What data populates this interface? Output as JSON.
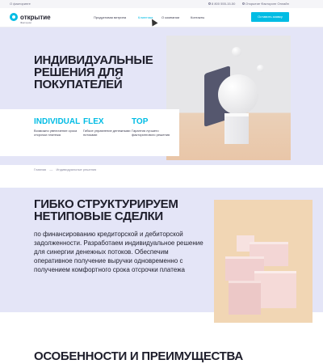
{
  "topbar": {
    "about": "О факторинге",
    "phone": "8 800 555-15-50",
    "online": "Открытие Факторинг Онлайн"
  },
  "header": {
    "logo_text": "открытие",
    "logo_sub": "Факторинг",
    "nav": [
      {
        "label": "Продуктовая витрина",
        "active": false
      },
      {
        "label": "Клиентам",
        "active": true
      },
      {
        "label": "О компании",
        "active": false
      },
      {
        "label": "Контакты",
        "active": false
      }
    ],
    "cta": "Оставить заявку"
  },
  "hero": {
    "title": "ИНДИВИДУАЛЬНЫЕ РЕШЕНИЯ ДЛЯ ПОКУПАТЕЛЕЙ",
    "features": [
      {
        "title": "INDIVIDUAL",
        "text": "Возможно увеличение срока отсрочки платежа"
      },
      {
        "title": "FLEX",
        "text": "Гибкое управление денежными потоками"
      },
      {
        "title": "TOP",
        "text": "Гарантия лучшего факторингового решения"
      }
    ]
  },
  "breadcrumb": {
    "home": "Главная",
    "separator": "—",
    "current": "Индивидуальные решения"
  },
  "section2": {
    "title": "ГИБКО СТРУКТУРИРУЕМ НЕТИПОВЫЕ СДЕЛКИ",
    "text": "по финансированию кредиторской и дебиторской задолженности. Разработаем индивидуальное решение для синергии денежных потоков. Обеспечим оперативное получение выручки одновременно с получением комфортного срока отсрочки платежа"
  },
  "section3": {
    "title": "ОСОБЕННОСТИ И ПРЕИМУЩЕСТВА"
  },
  "colors": {
    "accent": "#00bce4",
    "hero_bg": "#e4e5f7",
    "text": "#1e1e2b"
  }
}
